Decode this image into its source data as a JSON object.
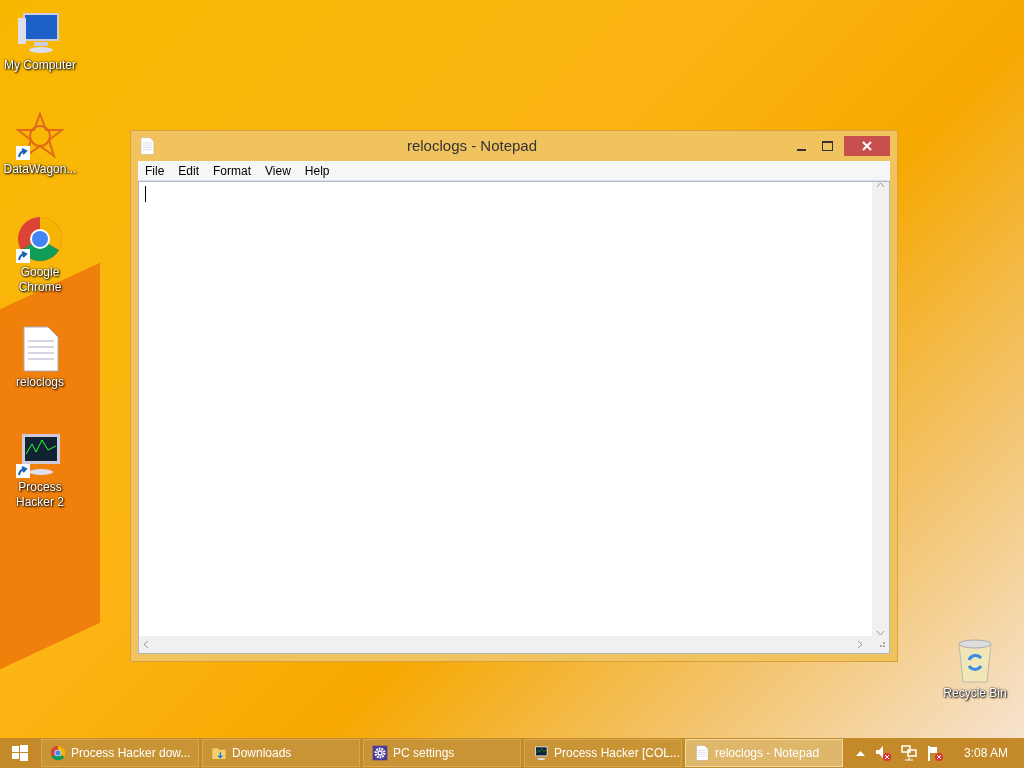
{
  "desktop_icons": [
    {
      "label": "My Computer",
      "kind": "computer",
      "shortcut": false
    },
    {
      "label": "DataWagon...",
      "kind": "star",
      "shortcut": true
    },
    {
      "label": "Google Chrome",
      "kind": "chrome",
      "shortcut": true
    },
    {
      "label": "reloclogs",
      "kind": "document",
      "shortcut": false
    },
    {
      "label": "Process Hacker 2",
      "kind": "monitor",
      "shortcut": true
    },
    {
      "label": "Recycle Bin",
      "kind": "bin",
      "shortcut": false
    }
  ],
  "window": {
    "title": "reloclogs - Notepad",
    "menu": [
      "File",
      "Edit",
      "Format",
      "View",
      "Help"
    ]
  },
  "taskbar": {
    "items": [
      {
        "label": "Process Hacker dow...",
        "kind": "chrome",
        "selected": false
      },
      {
        "label": "Downloads",
        "kind": "folder",
        "selected": false
      },
      {
        "label": "PC settings",
        "kind": "gear",
        "selected": false
      },
      {
        "label": "Process Hacker [COL...",
        "kind": "monitor",
        "selected": false
      },
      {
        "label": "reloclogs - Notepad",
        "kind": "document",
        "selected": true
      }
    ],
    "clock": "3:08 AM"
  }
}
